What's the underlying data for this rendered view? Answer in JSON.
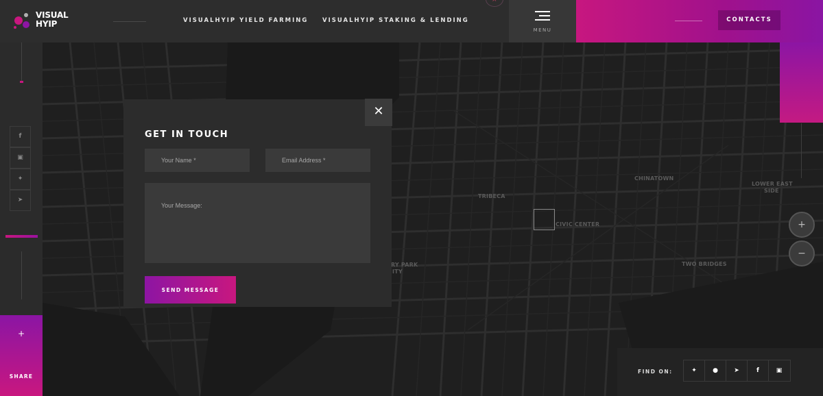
{
  "header": {
    "logo_line1": "VISUAL",
    "logo_line2": "HYIP",
    "nav": [
      {
        "label": "VISUALHYIP YIELD FARMING"
      },
      {
        "label": "VISUALHYIP STAKING & LENDING"
      }
    ],
    "menu_label": "MENU",
    "contacts_label": "CONTACTS",
    "top_close_glyph": "×"
  },
  "sidebar": {
    "social": [
      {
        "icon": "facebook-icon",
        "glyph": "f"
      },
      {
        "icon": "vk-icon",
        "glyph": "▣"
      },
      {
        "icon": "twitter-icon",
        "glyph": "✦"
      },
      {
        "icon": "telegram-icon",
        "glyph": "➤"
      }
    ],
    "share_plus": "+",
    "share_label": "SHARE"
  },
  "modal": {
    "close_glyph": "✕",
    "title": "GET IN TOUCH",
    "name_placeholder": "Your Name *",
    "email_placeholder": "Email Address *",
    "message_placeholder": "Your Message:",
    "send_label": "SEND MESSAGE"
  },
  "map": {
    "labels": [
      {
        "text": "TRIBECA"
      },
      {
        "text": "CIVIC CENTER"
      },
      {
        "text": "CHINATOWN"
      },
      {
        "text": "LOWER EAST"
      },
      {
        "text": "SIDE"
      },
      {
        "text": "TWO BRIDGES"
      },
      {
        "text": "RY PARK"
      },
      {
        "text": "ITY"
      }
    ],
    "zoom_in": "+",
    "zoom_out": "−"
  },
  "findon": {
    "label": "FIND ON:",
    "icons": [
      {
        "icon": "twitter-icon",
        "glyph": "✦"
      },
      {
        "icon": "telegram-circle-icon",
        "glyph": "●"
      },
      {
        "icon": "telegram-icon",
        "glyph": "➤"
      },
      {
        "icon": "facebook-circle-icon",
        "glyph": "f"
      },
      {
        "icon": "vk-icon",
        "glyph": "▣"
      }
    ]
  },
  "colors": {
    "accent_pink": "#c8177f",
    "accent_purple": "#8d15a3",
    "background": "#1c1c1c"
  }
}
